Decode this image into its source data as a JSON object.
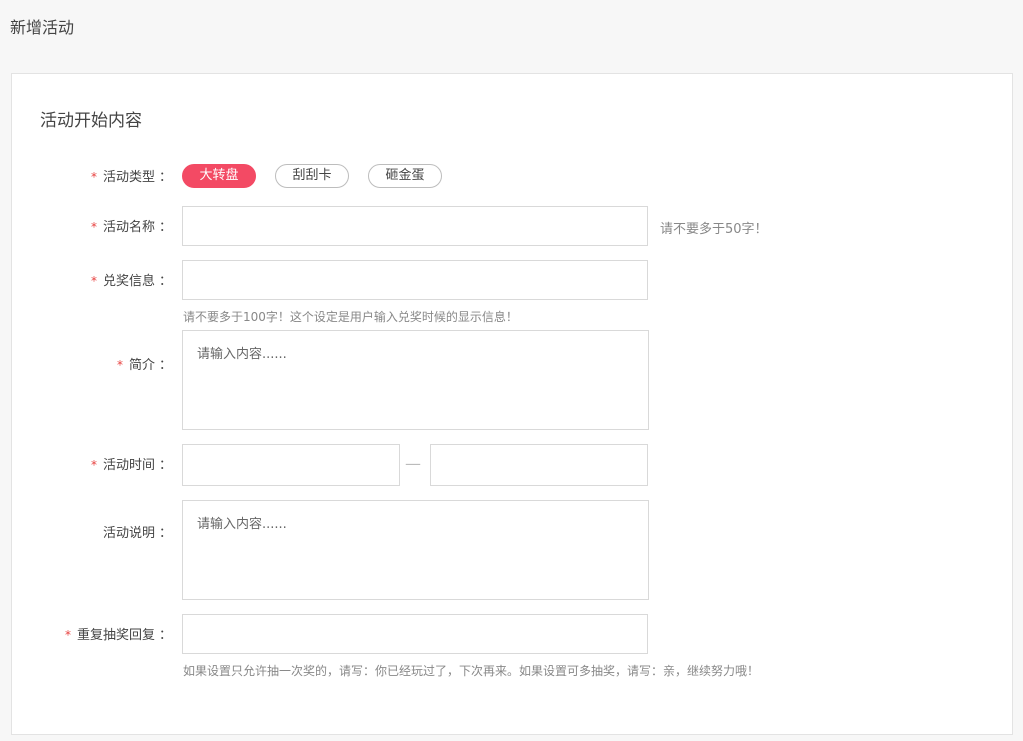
{
  "page": {
    "title": "新增活动"
  },
  "section": {
    "title": "活动开始内容"
  },
  "form": {
    "activity_type": {
      "label": "活动类型",
      "options": [
        "大转盘",
        "刮刮卡",
        "砸金蛋"
      ],
      "selected": "大转盘"
    },
    "activity_name": {
      "label": "活动名称",
      "value": "",
      "hint": "请不要多于50字！"
    },
    "prize_info": {
      "label": "兑奖信息",
      "value": "",
      "hint": "请不要多于100字！这个设定是用户输入兑奖时候的显示信息！"
    },
    "intro": {
      "label": "简介",
      "placeholder": "请输入内容......"
    },
    "activity_time": {
      "label": "活动时间",
      "start": "",
      "end": "",
      "separator": "—"
    },
    "activity_desc": {
      "label": "活动说明",
      "placeholder": "请输入内容......"
    },
    "repeat_reply": {
      "label": "重复抽奖回复",
      "value": "",
      "hint": "如果设置只允许抽一次奖的，请写：你已经玩过了，下次再来。如果设置可多抽奖，请写：亲，继续努力哦！"
    }
  },
  "colors": {
    "accent": "#f34a64",
    "required": "#e8413f"
  }
}
